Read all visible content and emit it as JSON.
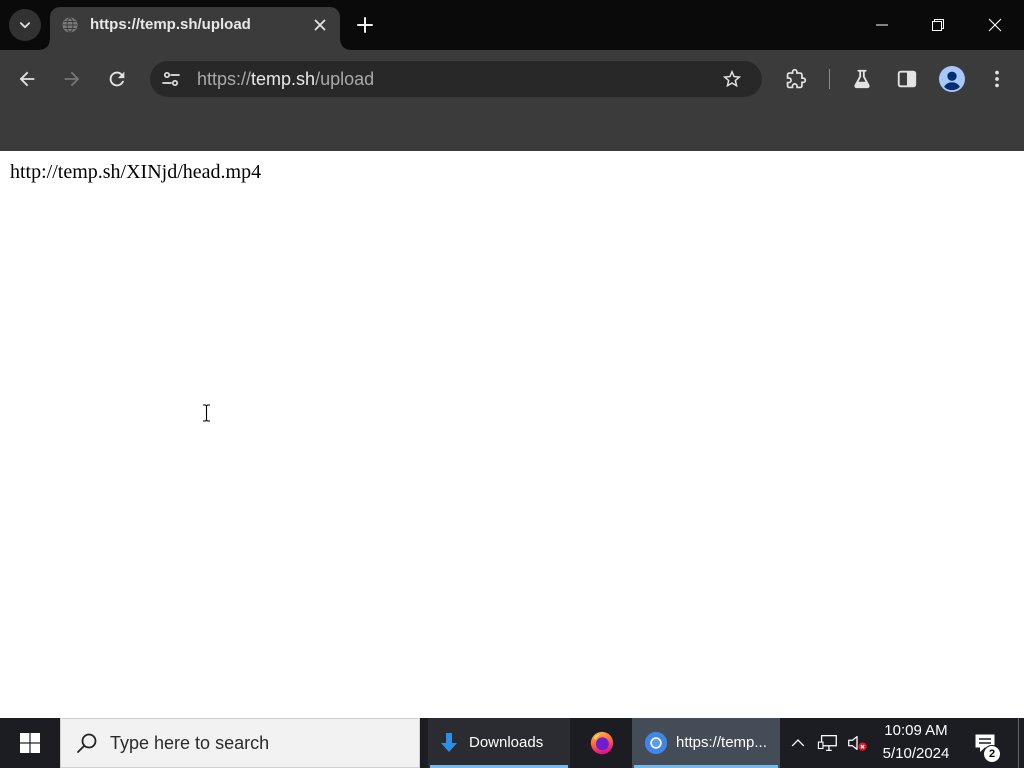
{
  "colors": {
    "tab_strip_bg": "#0a0a0a",
    "toolbar_bg": "#3b3b3b",
    "omnibox_bg": "#282828",
    "page_bg": "#ffffff",
    "taskbar_bg": "#1b1d22",
    "taskbar_active_bg": "#444c57",
    "taskbar_running_indicator": "#76b9ed"
  },
  "browser": {
    "tab_search": {
      "icon": "chevron-down-icon"
    },
    "tabs": [
      {
        "title": "https://temp.sh/upload",
        "favicon": "globe-icon",
        "close_icon": "close-icon",
        "active": true
      }
    ],
    "new_tab": {
      "icon": "plus-icon"
    },
    "window_controls": {
      "minimize": "minimize-icon",
      "restore": "restore-icon",
      "close": "close-icon"
    },
    "toolbar": {
      "back": {
        "icon": "arrow-back-icon",
        "enabled": true
      },
      "forward": {
        "icon": "arrow-forward-icon",
        "enabled": false
      },
      "reload": {
        "icon": "reload-icon"
      },
      "omnibox": {
        "site_info_icon": "tune-icon",
        "url": {
          "scheme": "https://",
          "host": "temp.sh",
          "path": "/upload"
        },
        "bookmark_icon": "star-outline-icon"
      },
      "extensions_icon": "puzzle-icon",
      "labs_icon": "flask-icon",
      "side_panel_icon": "side-panel-icon",
      "profile_icon": "avatar-icon",
      "menu_icon": "kebab-menu-icon"
    }
  },
  "page": {
    "body_text": "http://temp.sh/XINjd/head.mp4",
    "mouse_cursor": "i-beam-cursor-icon"
  },
  "taskbar": {
    "start_icon": "windows-logo-icon",
    "search": {
      "icon": "search-icon",
      "placeholder": "Type here to search"
    },
    "apps": [
      {
        "label": "Downloads",
        "icon": "download-arrow-icon",
        "running": true,
        "active": false
      },
      {
        "icon": "firefox-icon",
        "running": false,
        "active": false
      },
      {
        "label": "https://temp...",
        "icon": "chrome-icon",
        "running": true,
        "active": true
      }
    ],
    "tray": {
      "overflow_icon": "chevron-up-icon",
      "network_icon": "network-icon",
      "volume_icon": "volume-error-icon",
      "clock": {
        "time": "10:09 AM",
        "date": "5/10/2024"
      },
      "notifications": {
        "icon": "action-center-icon",
        "count": "2"
      }
    }
  }
}
